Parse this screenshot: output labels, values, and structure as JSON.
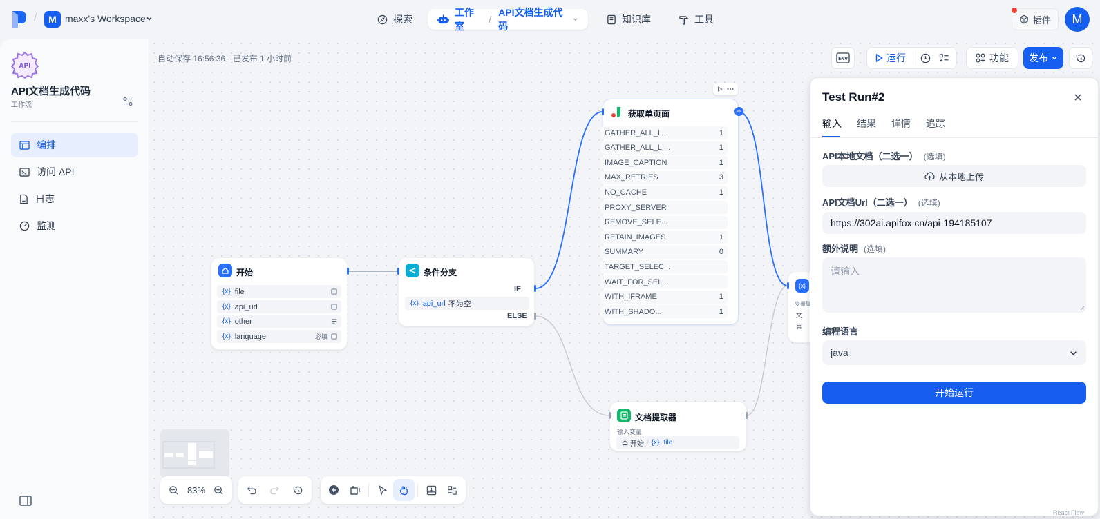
{
  "workspace": {
    "badge": "M",
    "name": "maxx's Workspace"
  },
  "nav": {
    "explore": "探索",
    "studio": "工作室",
    "separator": "/",
    "app_name": "API文档生成代码",
    "knowledge": "知识库",
    "tools": "工具"
  },
  "header": {
    "plugin_label": "插件",
    "avatar_letter": "M"
  },
  "sidebar": {
    "app_name": "API文档生成代码",
    "app_type": "工作流",
    "app_icon_text": "API",
    "items": [
      {
        "label": "编排",
        "active": true
      },
      {
        "label": "访问 API"
      },
      {
        "label": "日志"
      },
      {
        "label": "监测"
      }
    ]
  },
  "toolbar": {
    "autosave": "自动保存 16:56:36 · 已发布 1 小时前",
    "env": "ENV",
    "run": "运行",
    "features": "功能",
    "publish": "发布"
  },
  "nodes": {
    "start": {
      "title": "开始",
      "vars": [
        {
          "name": "file",
          "tag": ""
        },
        {
          "name": "api_url",
          "tag": ""
        },
        {
          "name": "other",
          "tag": ""
        },
        {
          "name": "language",
          "tag": "必填"
        }
      ]
    },
    "condition": {
      "title": "条件分支",
      "if_label": "IF",
      "else_label": "ELSE",
      "cond_var": "api_url",
      "cond_op": "不为空"
    },
    "fetch": {
      "title": "获取单页面",
      "params": [
        {
          "name": "GATHER_ALL_I...",
          "value": "1"
        },
        {
          "name": "GATHER_ALL_LI...",
          "value": "1"
        },
        {
          "name": "IMAGE_CAPTION",
          "value": "1"
        },
        {
          "name": "MAX_RETRIES",
          "value": "3"
        },
        {
          "name": "NO_CACHE",
          "value": "1"
        },
        {
          "name": "PROXY_SERVER",
          "value": ""
        },
        {
          "name": "REMOVE_SELE...",
          "value": ""
        },
        {
          "name": "RETAIN_IMAGES",
          "value": "1"
        },
        {
          "name": "SUMMARY",
          "value": "0"
        },
        {
          "name": "TARGET_SELEC...",
          "value": ""
        },
        {
          "name": "WAIT_FOR_SEL...",
          "value": ""
        },
        {
          "name": "WITH_IFRAME",
          "value": "1"
        },
        {
          "name": "WITH_SHADO...",
          "value": "1"
        }
      ]
    },
    "extractor": {
      "title": "文档提取器",
      "input_label": "输入变量",
      "source": "开始",
      "var": "file"
    },
    "partial": {
      "label": "变量聚",
      "row1": "文",
      "row2": "言"
    }
  },
  "panel": {
    "title": "Test Run#2",
    "tabs": [
      "输入",
      "结果",
      "详情",
      "追踪"
    ],
    "fields": {
      "local_doc_label": "API本地文档（二选一）",
      "optional": "(选填)",
      "upload_label": "从本地上传",
      "url_label": "API文档Url（二选一）",
      "url_value": "https://302ai.apifox.cn/api-194185107",
      "extra_label": "额外说明",
      "extra_placeholder": "请输入",
      "lang_label": "编程语言",
      "lang_value": "java"
    },
    "run_button": "开始运行"
  },
  "bottom": {
    "zoom": "83%"
  },
  "footer": {
    "react_flow": "React Flow"
  }
}
